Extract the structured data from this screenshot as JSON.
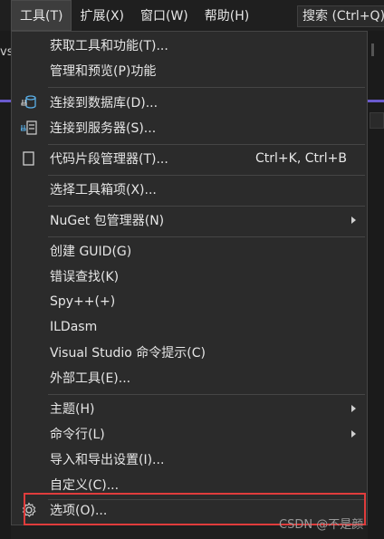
{
  "menubar": {
    "items": [
      {
        "label": "工具(T)"
      },
      {
        "label": "扩展(X)"
      },
      {
        "label": "窗口(W)"
      },
      {
        "label": "帮助(H)"
      }
    ],
    "search_label": "搜索 (Ctrl+Q)"
  },
  "background": {
    "partial_text": "vs"
  },
  "menu": {
    "get_tools": "获取工具和功能(T)...",
    "manage_preview": "管理和预览(P)功能",
    "connect_db": "连接到数据库(D)...",
    "connect_server": "连接到服务器(S)...",
    "snippets": "代码片段管理器(T)...",
    "snippets_shortcut": "Ctrl+K, Ctrl+B",
    "choose_toolbox": "选择工具箱项(X)...",
    "nuget": "NuGet 包管理器(N)",
    "create_guid": "创建 GUID(G)",
    "error_lookup": "错误查找(K)",
    "spy": "Spy++(+)",
    "ildasm": "ILDasm",
    "vs_prompt": "Visual Studio 命令提示(C)",
    "external_tools": "外部工具(E)...",
    "theme": "主题(H)",
    "command_line": "命令行(L)",
    "import_export": "导入和导出设置(I)...",
    "customize": "自定义(C)...",
    "options": "选项(O)..."
  },
  "icons": {
    "connect_db": "database-plug-icon",
    "connect_server": "server-plug-icon",
    "snippets": "snippet-icon",
    "options": "gear-icon"
  },
  "colors": {
    "menu_bg": "#2b2b2b",
    "highlight": "#e03c3c"
  },
  "watermark": "CSDN @不是颜"
}
